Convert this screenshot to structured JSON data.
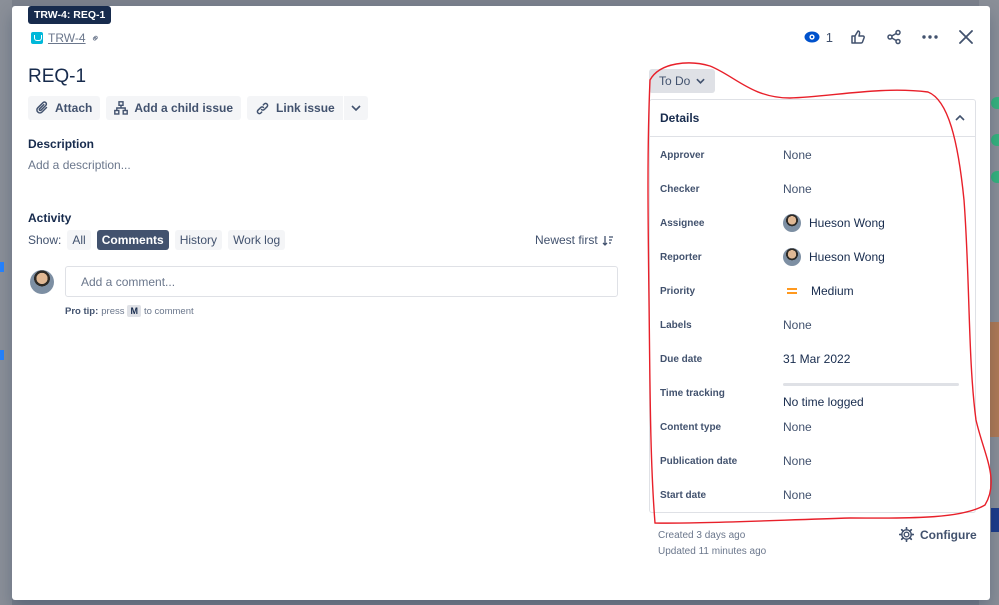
{
  "tooltip": "TRW-4: REQ-1",
  "breadcrumb": {
    "key": "TRW-4"
  },
  "header": {
    "watch_count": "1"
  },
  "issue": {
    "title": "REQ-1"
  },
  "toolbar": {
    "attach": "Attach",
    "add_child": "Add a child issue",
    "link_issue": "Link issue"
  },
  "description": {
    "label": "Description",
    "placeholder": "Add a description..."
  },
  "activity": {
    "label": "Activity",
    "show_label": "Show:",
    "filters": [
      "All",
      "Comments",
      "History",
      "Work log"
    ],
    "active_filter": "Comments",
    "sort": "Newest first"
  },
  "comment": {
    "placeholder": "Add a comment...",
    "protip_bold": "Pro tip:",
    "protip_press": "press",
    "protip_key": "M",
    "protip_rest": "to comment"
  },
  "status": {
    "label": "To Do"
  },
  "details": {
    "title": "Details",
    "fields": [
      {
        "label": "Approver",
        "value": "None"
      },
      {
        "label": "Checker",
        "value": "None"
      },
      {
        "label": "Assignee",
        "value": "Hueson Wong"
      },
      {
        "label": "Reporter",
        "value": "Hueson Wong"
      },
      {
        "label": "Priority",
        "value": "Medium"
      },
      {
        "label": "Labels",
        "value": "None"
      },
      {
        "label": "Due date",
        "value": "31 Mar 2022"
      },
      {
        "label": "Time tracking",
        "value": "No time logged"
      },
      {
        "label": "Content type",
        "value": "None"
      },
      {
        "label": "Publication date",
        "value": "None"
      },
      {
        "label": "Start date",
        "value": "None"
      }
    ]
  },
  "footer": {
    "created": "Created 3 days ago",
    "updated": "Updated 11 minutes ago",
    "configure": "Configure"
  },
  "colors": {
    "annotation": "#e8202a",
    "priority_medium": "#ff991f",
    "watch_eye": "#0052cc"
  }
}
